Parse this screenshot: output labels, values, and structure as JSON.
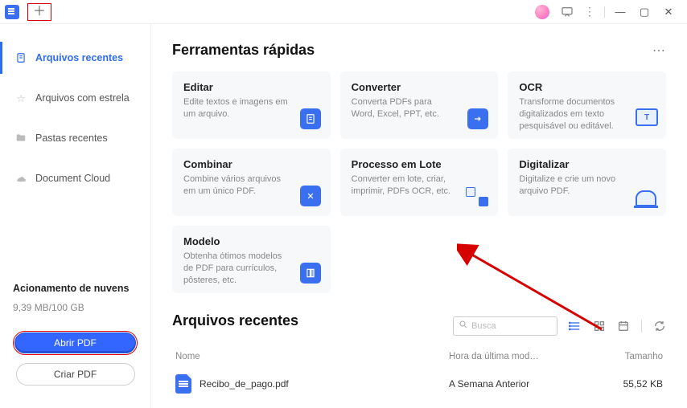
{
  "sidebar": {
    "items": [
      {
        "label": "Arquivos recentes"
      },
      {
        "label": "Arquivos com estrela"
      },
      {
        "label": "Pastas recentes"
      },
      {
        "label": "Document Cloud"
      }
    ],
    "cloud_title": "Acionamento de nuvens",
    "cloud_usage": "9,39 MB/100 GB",
    "open_pdf": "Abrir PDF",
    "create_pdf": "Criar PDF"
  },
  "sections": {
    "tools_title": "Ferramentas rápidas",
    "recent_title": "Arquivos recentes"
  },
  "tools": [
    {
      "title": "Editar",
      "desc": "Edite textos e imagens em um arquivo."
    },
    {
      "title": "Converter",
      "desc": "Converta PDFs para Word, Excel, PPT, etc."
    },
    {
      "title": "OCR",
      "desc": "Transforme documentos digitalizados em texto pesquisável ou editável."
    },
    {
      "title": "Combinar",
      "desc": "Combine vários arquivos em um único PDF."
    },
    {
      "title": "Processo em Lote",
      "desc": "Converter em lote, criar, imprimir, PDFs OCR, etc."
    },
    {
      "title": "Digitalizar",
      "desc": "Digitalize e crie um novo arquivo PDF."
    },
    {
      "title": "Modelo",
      "desc": "Obtenha ótimos modelos de PDF para currículos, pôsteres, etc."
    }
  ],
  "search": {
    "placeholder": "Busca"
  },
  "table": {
    "headers": {
      "name": "Nome",
      "modified": "Hora da última mod…",
      "size": "Tamanho"
    },
    "rows": [
      {
        "name": "Recibo_de_pago.pdf",
        "modified": "A Semana Anterior",
        "size": "55,52 KB"
      }
    ]
  }
}
